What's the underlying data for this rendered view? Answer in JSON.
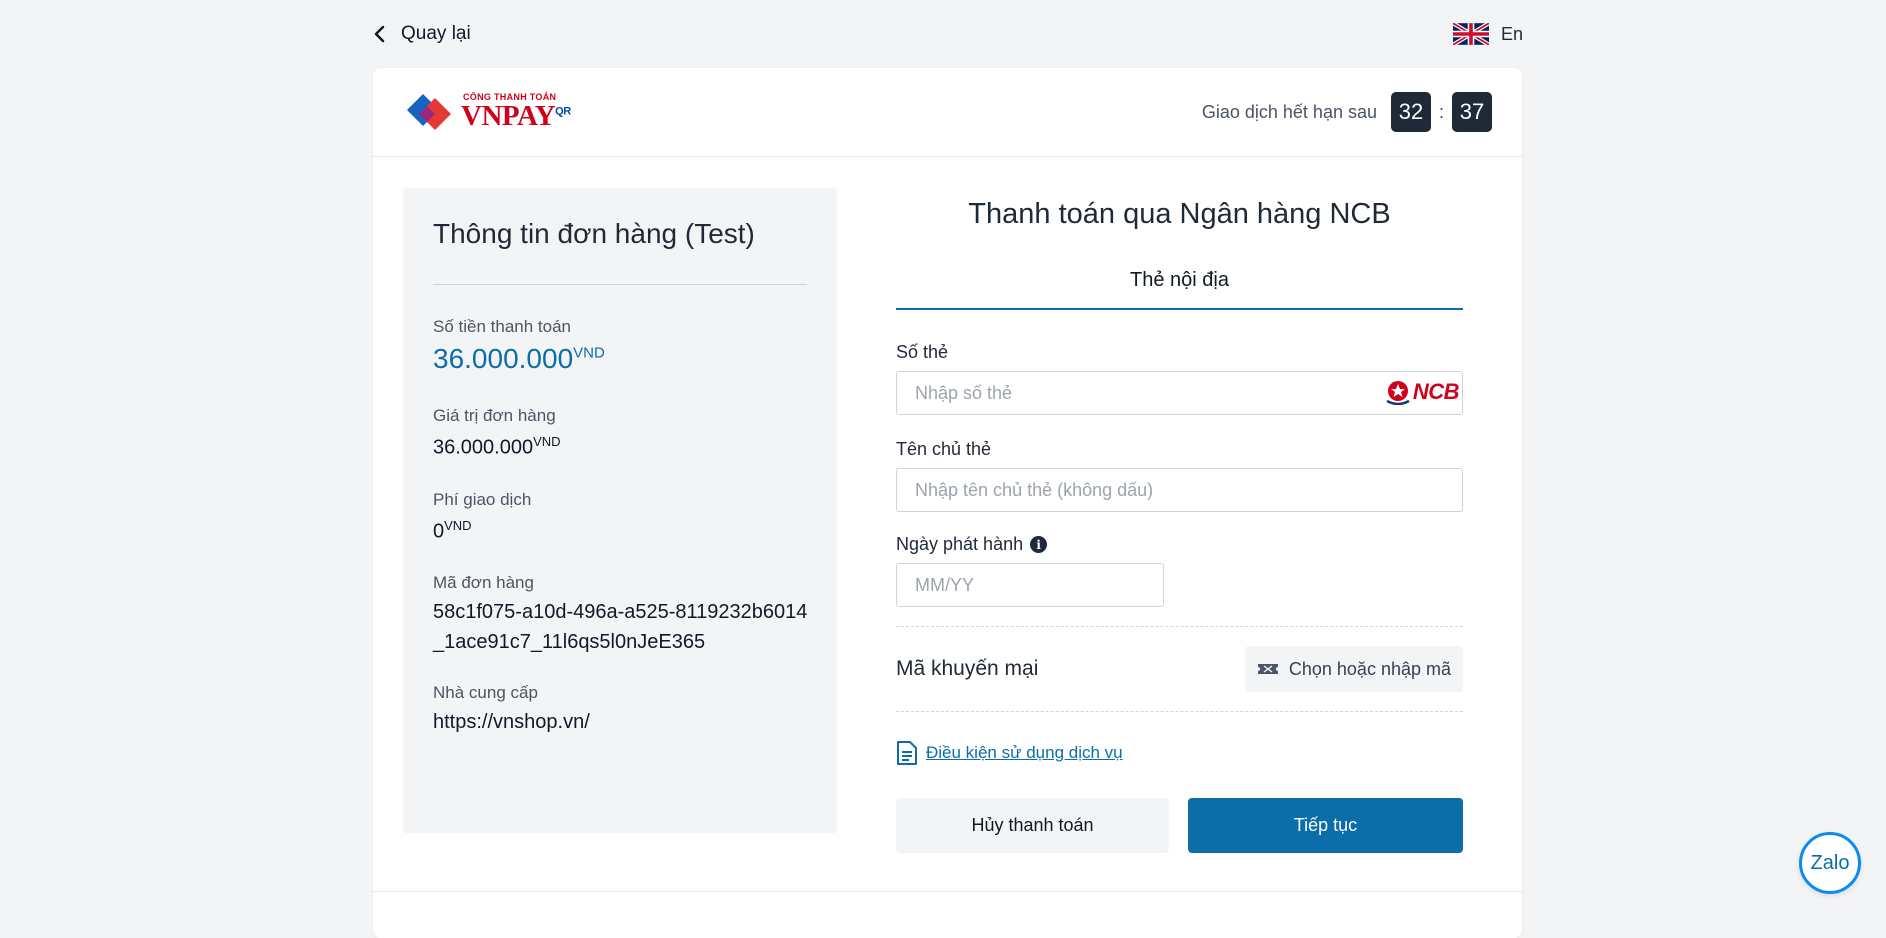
{
  "nav": {
    "back_label": "Quay lại",
    "language_label": "En"
  },
  "header": {
    "logo_tagline": "CỔNG THANH TOÁN",
    "logo_brand": "VNPAY",
    "logo_suffix": "QR",
    "timer_label": "Giao dịch hết hạn sau",
    "timer_minutes": "32",
    "timer_separator": ":",
    "timer_seconds": "37"
  },
  "order": {
    "title": "Thông tin đơn hàng (Test)",
    "amount_label": "Số tiền thanh toán",
    "amount_value": "36.000.000",
    "currency": "VND",
    "order_value_label": "Giá trị đơn hàng",
    "order_value": "36.000.000",
    "fee_label": "Phí giao dịch",
    "fee_value": "0",
    "order_id_label": "Mã đơn hàng",
    "order_id": "58c1f075-a10d-496a-a525-8119232b6014_1ace91c7_11l6qs5l0nJeE365",
    "provider_label": "Nhà cung cấp",
    "provider_value": "https://vnshop.vn/"
  },
  "payment": {
    "title": "Thanh toán qua Ngân hàng NCB",
    "tab_label": "Thẻ nội địa",
    "card_number_label": "Số thẻ",
    "card_number_placeholder": "Nhập số thẻ",
    "bank_logo": "NCB",
    "holder_label": "Tên chủ thẻ",
    "holder_placeholder": "Nhập tên chủ thẻ (không dấu)",
    "issue_date_label": "Ngày phát hành",
    "issue_date_placeholder": "MM/YY",
    "promo_label": "Mã khuyến mại",
    "promo_button": "Chọn hoặc nhập mã",
    "terms_link": "Điều kiện sử dụng dịch vụ",
    "cancel_button": "Hủy thanh toán",
    "continue_button": "Tiếp tục"
  },
  "widgets": {
    "zalo_label": "Zalo"
  },
  "colors": {
    "accent": "#0b6ea9",
    "brand_red": "#d0021b",
    "timer_bg": "#1f2937"
  }
}
